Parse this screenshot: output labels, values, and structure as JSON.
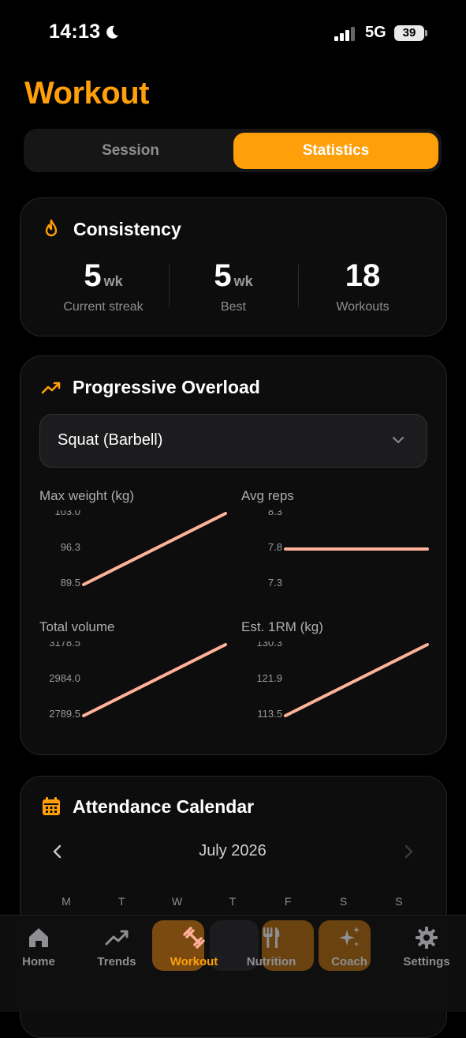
{
  "status_bar": {
    "time": "14:13",
    "network": "5G",
    "battery": "39"
  },
  "page_title": "Workout",
  "segments": {
    "session": "Session",
    "statistics": "Statistics",
    "selected": "Statistics"
  },
  "consistency": {
    "title": "Consistency",
    "stats": [
      {
        "value": "5",
        "unit": "wk",
        "label": "Current streak"
      },
      {
        "value": "5",
        "unit": "wk",
        "label": "Best"
      },
      {
        "value": "18",
        "unit": "",
        "label": "Workouts"
      }
    ]
  },
  "overload": {
    "title": "Progressive Overload",
    "exercise": "Squat (Barbell)"
  },
  "chart_data": [
    {
      "type": "line",
      "title": "Max weight (kg)",
      "yticks": [
        "103.0",
        "96.3",
        "89.5"
      ],
      "ylim": [
        89.5,
        103.0
      ],
      "x": [
        1,
        2
      ],
      "values": [
        89.5,
        103.0
      ],
      "color": "#ffb199"
    },
    {
      "type": "line",
      "title": "Avg reps",
      "yticks": [
        "8.3",
        "7.8",
        "7.3"
      ],
      "ylim": [
        7.3,
        8.3
      ],
      "x": [
        1,
        2
      ],
      "values": [
        7.8,
        7.8
      ],
      "color": "#ffb199"
    },
    {
      "type": "line",
      "title": "Total volume",
      "yticks": [
        "3178.5",
        "2984.0",
        "2789.5"
      ],
      "ylim": [
        2789.5,
        3178.5
      ],
      "x": [
        1,
        2
      ],
      "values": [
        2789.5,
        3178.5
      ],
      "color": "#ffb199"
    },
    {
      "type": "line",
      "title": "Est. 1RM (kg)",
      "yticks": [
        "130.3",
        "121.9",
        "113.5"
      ],
      "ylim": [
        113.5,
        130.3
      ],
      "x": [
        1,
        2
      ],
      "values": [
        113.5,
        130.3
      ],
      "color": "#ffb199"
    }
  ],
  "calendar": {
    "title": "Attendance Calendar",
    "month": "July 2026",
    "weekdays": [
      "M",
      "T",
      "W",
      "T",
      "F",
      "S",
      "S"
    ]
  },
  "tabs": [
    {
      "label": "Home",
      "icon": "home-icon"
    },
    {
      "label": "Trends",
      "icon": "trend-icon"
    },
    {
      "label": "Workout",
      "icon": "dumbbell-icon"
    },
    {
      "label": "Nutrition",
      "icon": "fork-knife-icon"
    },
    {
      "label": "Coach",
      "icon": "sparkles-icon"
    },
    {
      "label": "Settings",
      "icon": "gear-icon"
    }
  ],
  "colors": {
    "accent": "#ff9f0a",
    "line": "#ffb199"
  }
}
